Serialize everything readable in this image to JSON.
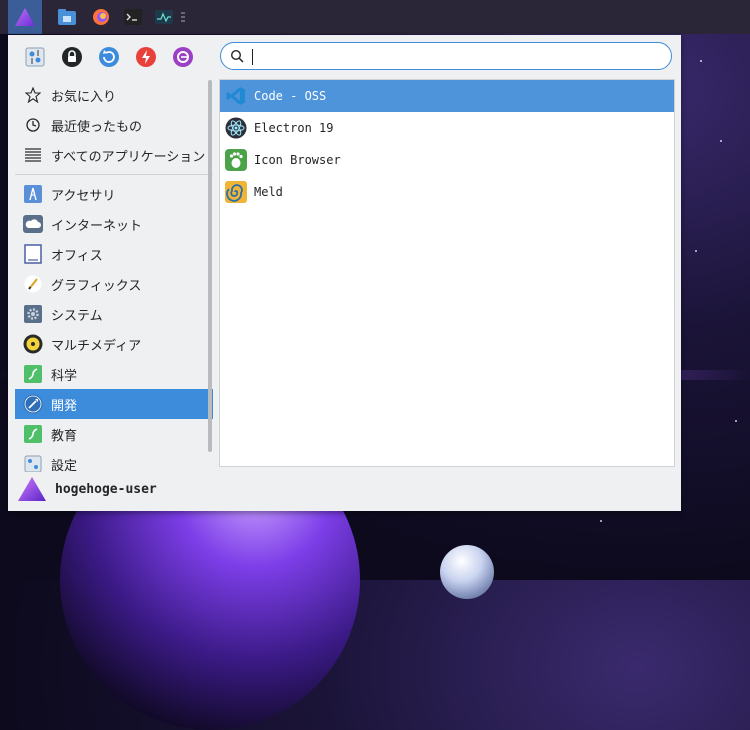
{
  "taskbar": {
    "start_icon": "kde-menu-icon",
    "apps": [
      "file-manager-icon",
      "firefox-icon",
      "terminal-icon",
      "system-monitor-icon"
    ]
  },
  "quick_actions": [
    "system-settings-icon",
    "lock-screen-icon",
    "restart-icon",
    "shutdown-icon",
    "logout-icon"
  ],
  "search": {
    "value": "",
    "placeholder": ""
  },
  "categories": [
    {
      "label": "お気に入り",
      "icon": "star-icon"
    },
    {
      "label": "最近使ったもの",
      "icon": "history-icon"
    },
    {
      "label": "すべてのアプリケーション",
      "icon": "list-icon"
    },
    {
      "label": "アクセサリ",
      "icon": "accessories-icon"
    },
    {
      "label": "インターネット",
      "icon": "cloud-icon"
    },
    {
      "label": "オフィス",
      "icon": "office-icon"
    },
    {
      "label": "グラフィックス",
      "icon": "graphics-icon"
    },
    {
      "label": "システム",
      "icon": "system-gear-icon"
    },
    {
      "label": "マルチメディア",
      "icon": "multimedia-icon"
    },
    {
      "label": "科学",
      "icon": "science-icon"
    },
    {
      "label": "開発",
      "icon": "development-icon"
    },
    {
      "label": "教育",
      "icon": "education-icon"
    },
    {
      "label": "設定",
      "icon": "settings-icon"
    }
  ],
  "selected_category": "開発",
  "apps": [
    {
      "label": "Code - OSS",
      "icon": "vscode-icon"
    },
    {
      "label": "Electron 19",
      "icon": "electron-icon"
    },
    {
      "label": "Icon Browser",
      "icon": "gnome-foot-icon"
    },
    {
      "label": "Meld",
      "icon": "meld-icon"
    }
  ],
  "selected_app": "Code - OSS",
  "user": {
    "name": "hogehoge-user"
  },
  "colors": {
    "accent": "#3d8bdb",
    "selection": "#4e94db",
    "taskbar": "#2b2637"
  }
}
